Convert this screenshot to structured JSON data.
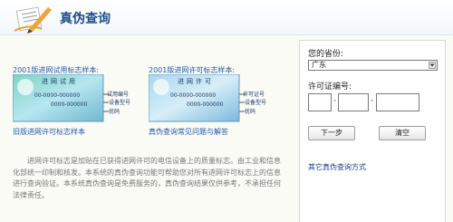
{
  "header": {
    "title": "真伪查询"
  },
  "samples": {
    "card1": {
      "heading": "2001版进网试用标志样本:",
      "title": "进网试用",
      "line1": "00-0000-000000",
      "line2": "0000-000000",
      "annot1": "试用编号",
      "annot2": "设备型号",
      "annot3": "扰码",
      "footer": "旧版进网许可标志样本"
    },
    "card2": {
      "heading": "2001版进网许可标志样本:",
      "title": "进网许可",
      "line1": "00-0000-000000",
      "line2": "0000-000000",
      "annot1": "许可证号",
      "annot2": "设备型号",
      "annot3": "扰码",
      "footer": "真伪查询常见问题与解答"
    }
  },
  "description": "进网许可标志是加贴在已获得进网许可的电信设备上的质量标志。由工业和信息化部统一印制和核发。本系统的真伪查询功能可帮助您对所有进网许可标志上的信息进行查询验证。本系统真伪查询是免费服务的，真伪查询结果仅供参考，不承担任何法律责任。",
  "form": {
    "province_label": "您的省份:",
    "province_value": "广东",
    "license_label": "许可证编号:",
    "next_button": "下一步",
    "clear_button": "清空",
    "other_link": "其它真伪查询方式"
  }
}
